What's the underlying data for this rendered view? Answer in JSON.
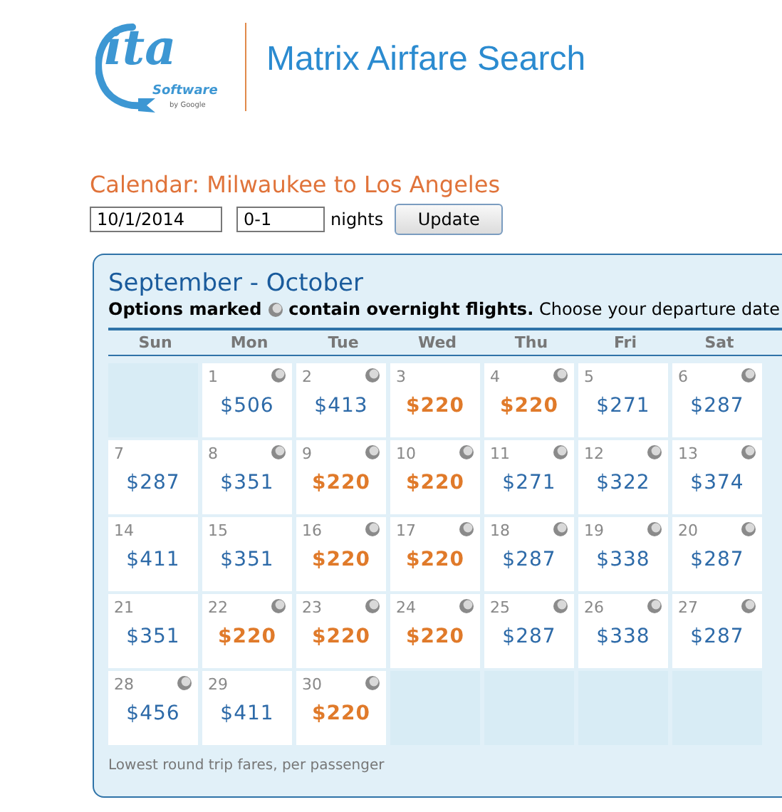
{
  "logo": {
    "mark": "ita",
    "software": "Software",
    "by": "by Google"
  },
  "title": "Matrix Airfare Search",
  "heading": "Calendar: Milwaukee to Los Angeles",
  "form": {
    "date": "10/1/2014",
    "nights": "0-1",
    "nights_label": "nights",
    "button": "Update"
  },
  "calendar": {
    "month": "September - October",
    "legend_before": "Options marked",
    "legend_after": "**contain overnight flights.** Choose your departure date",
    "weekdays": [
      "Sun",
      "Mon",
      "Tue",
      "Wed",
      "Thu",
      "Fri",
      "Sat"
    ],
    "weeks": [
      [
        {
          "kind": "empty"
        },
        {
          "kind": "day",
          "day": "1",
          "price": "$506",
          "overnight": true,
          "lowest": false
        },
        {
          "kind": "day",
          "day": "2",
          "price": "$413",
          "overnight": true,
          "lowest": false
        },
        {
          "kind": "day",
          "day": "3",
          "price": "$220",
          "overnight": false,
          "lowest": true
        },
        {
          "kind": "day",
          "day": "4",
          "price": "$220",
          "overnight": true,
          "lowest": true
        },
        {
          "kind": "day",
          "day": "5",
          "price": "$271",
          "overnight": false,
          "lowest": false
        },
        {
          "kind": "day",
          "day": "6",
          "price": "$287",
          "overnight": true,
          "lowest": false
        }
      ],
      [
        {
          "kind": "day",
          "day": "7",
          "price": "$287",
          "overnight": false,
          "lowest": false
        },
        {
          "kind": "day",
          "day": "8",
          "price": "$351",
          "overnight": true,
          "lowest": false
        },
        {
          "kind": "day",
          "day": "9",
          "price": "$220",
          "overnight": true,
          "lowest": true
        },
        {
          "kind": "day",
          "day": "10",
          "price": "$220",
          "overnight": true,
          "lowest": true
        },
        {
          "kind": "day",
          "day": "11",
          "price": "$271",
          "overnight": true,
          "lowest": false
        },
        {
          "kind": "day",
          "day": "12",
          "price": "$322",
          "overnight": true,
          "lowest": false
        },
        {
          "kind": "day",
          "day": "13",
          "price": "$374",
          "overnight": true,
          "lowest": false
        }
      ],
      [
        {
          "kind": "day",
          "day": "14",
          "price": "$411",
          "overnight": false,
          "lowest": false
        },
        {
          "kind": "day",
          "day": "15",
          "price": "$351",
          "overnight": false,
          "lowest": false
        },
        {
          "kind": "day",
          "day": "16",
          "price": "$220",
          "overnight": true,
          "lowest": true
        },
        {
          "kind": "day",
          "day": "17",
          "price": "$220",
          "overnight": true,
          "lowest": true
        },
        {
          "kind": "day",
          "day": "18",
          "price": "$287",
          "overnight": true,
          "lowest": false
        },
        {
          "kind": "day",
          "day": "19",
          "price": "$338",
          "overnight": true,
          "lowest": false
        },
        {
          "kind": "day",
          "day": "20",
          "price": "$287",
          "overnight": true,
          "lowest": false
        }
      ],
      [
        {
          "kind": "day",
          "day": "21",
          "price": "$351",
          "overnight": false,
          "lowest": false
        },
        {
          "kind": "day",
          "day": "22",
          "price": "$220",
          "overnight": true,
          "lowest": true
        },
        {
          "kind": "day",
          "day": "23",
          "price": "$220",
          "overnight": true,
          "lowest": true
        },
        {
          "kind": "day",
          "day": "24",
          "price": "$220",
          "overnight": true,
          "lowest": true
        },
        {
          "kind": "day",
          "day": "25",
          "price": "$287",
          "overnight": true,
          "lowest": false
        },
        {
          "kind": "day",
          "day": "26",
          "price": "$338",
          "overnight": true,
          "lowest": false
        },
        {
          "kind": "day",
          "day": "27",
          "price": "$287",
          "overnight": true,
          "lowest": false
        }
      ],
      [
        {
          "kind": "day",
          "day": "28",
          "price": "$456",
          "overnight": true,
          "lowest": false
        },
        {
          "kind": "day",
          "day": "29",
          "price": "$411",
          "overnight": false,
          "lowest": false
        },
        {
          "kind": "day",
          "day": "30",
          "price": "$220",
          "overnight": true,
          "lowest": true
        },
        {
          "kind": "empty"
        },
        {
          "kind": "empty"
        },
        {
          "kind": "empty"
        },
        {
          "kind": "empty"
        }
      ]
    ],
    "footnote": "Lowest round trip fares, per passenger"
  }
}
